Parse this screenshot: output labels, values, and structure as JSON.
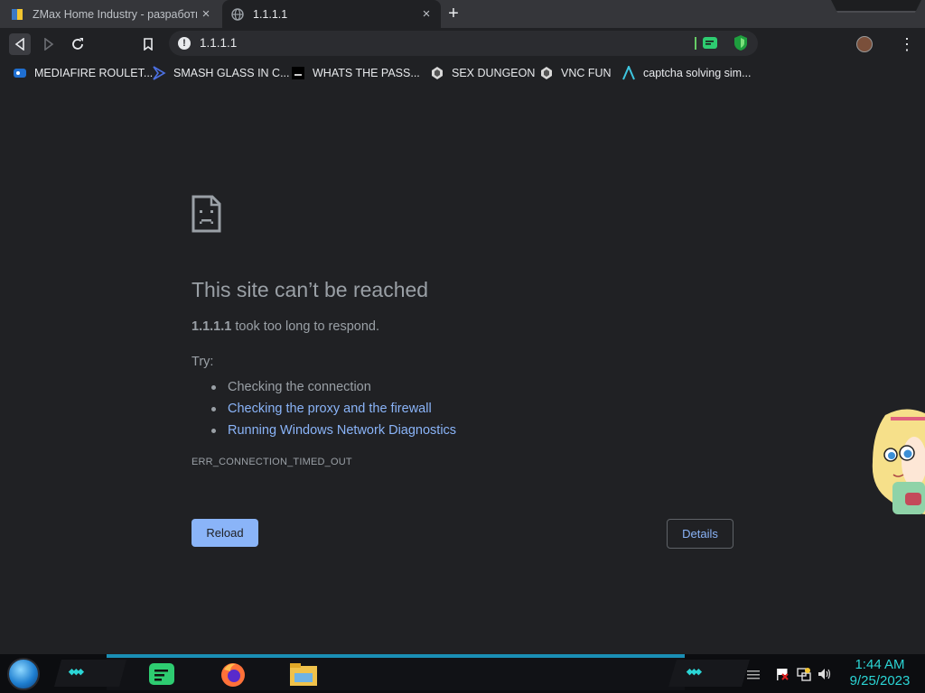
{
  "tabs": [
    {
      "title": "ZMax Home Industry - разработк",
      "close": "×",
      "active": false
    },
    {
      "title": "1.1.1.1",
      "close": "×",
      "active": true
    }
  ],
  "new_tab_glyph": "+",
  "toolbar": {
    "url": "1.1.1.1",
    "info_glyph": "!",
    "menu_glyph": "⋮",
    "back_icon": "back-icon",
    "forward_icon": "forward-icon",
    "reload_icon": "reload-icon",
    "bookmark_icon": "bookmark-icon"
  },
  "bookmarks": [
    {
      "label": "MEDIAFIRE ROULET...",
      "icon": "mediafire-icon"
    },
    {
      "label": "SMASH GLASS IN C...",
      "icon": "glass-icon"
    },
    {
      "label": "WHATS THE PASS...",
      "icon": "terminal-icon"
    },
    {
      "label": "SEX DUNGEON",
      "icon": "dungeon-icon"
    },
    {
      "label": "VNC FUN",
      "icon": "vnc-icon"
    },
    {
      "label": "captcha solving sim...",
      "icon": "captcha-icon"
    }
  ],
  "error": {
    "title": "This site can’t be reached",
    "host": "1.1.1.1",
    "message": " took too long to respond.",
    "try_label": "Try:",
    "suggestions": [
      {
        "text": "Checking the connection",
        "is_link": false
      },
      {
        "text": "Checking the proxy and the firewall",
        "is_link": true
      },
      {
        "text": "Running Windows Network Diagnostics",
        "is_link": true
      }
    ],
    "code": "ERR_CONNECTION_TIMED_OUT",
    "reload_label": "Reload",
    "details_label": "Details"
  },
  "taskbar": {
    "time": "1:44 AM",
    "date": "9/25/2023",
    "apps": [
      "spotify-icon",
      "firefox-icon",
      "file-explorer-icon"
    ]
  },
  "colors": {
    "page_bg": "#202124",
    "link": "#8ab4f8",
    "text": "#9aa0a6",
    "button": "#8ab4f8",
    "clock": "#2bd5d5"
  }
}
